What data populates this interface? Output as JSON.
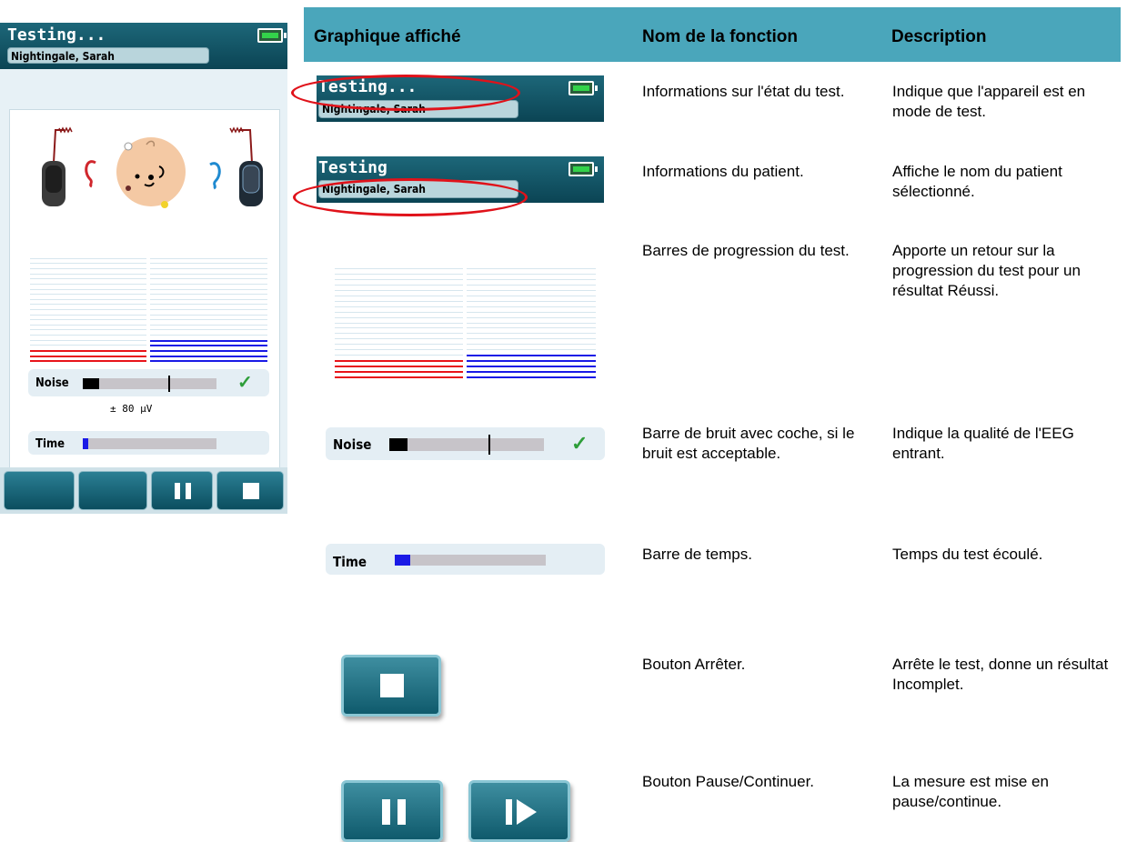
{
  "device": {
    "status_title": "Testing...",
    "patient_name": "Nightingale, Sarah",
    "noise_label": "Noise",
    "noise_value_text": "± 80 µV",
    "time_label": "Time",
    "noise_level": 0.12,
    "noise_threshold": 0.64,
    "time_progress": 0.04,
    "left_progress_lines": 3,
    "right_progress_lines": 5,
    "total_lines": 21,
    "colors": {
      "left_ear": "#e8141a",
      "right_ear": "#1a1ae6",
      "header": "#0b4454",
      "check": "#2e9e3a"
    },
    "icons": [
      "battery-icon",
      "left-ear-icon",
      "right-ear-icon",
      "baby-face-icon",
      "left-probe-icon",
      "right-probe-icon",
      "check-icon",
      "pause-icon",
      "stop-icon"
    ]
  },
  "table": {
    "headers": [
      "Graphique affiché",
      "Nom de la fonction",
      "Description"
    ],
    "rows": [
      {
        "function": "Informations sur l'état du test.",
        "description": "Indique que l'appareil est en mode de test."
      },
      {
        "function": "Informations du patient.",
        "description": "Affiche le nom du patient sélectionné."
      },
      {
        "function": "Barres de progression du test.",
        "description": "Apporte un retour sur la progression du test pour un résultat Réussi."
      },
      {
        "function": "Barre de bruit avec coche, si le bruit est acceptable.",
        "description": "Indique la qualité de l'EEG entrant."
      },
      {
        "function": "Barre de temps.",
        "description": "Temps du test écoulé."
      },
      {
        "function": "Bouton Arrêter.",
        "description": "Arrête le test, donne un résultat Incomplet."
      },
      {
        "function": "Bouton Pause/Continuer.",
        "description": "La mesure est mise en pause/continue."
      }
    ],
    "row1_title": "Testing...",
    "row1_name": "Nightingale, Sarah",
    "row2_title": "Testing",
    "row2_name": "Nightingale, Sarah",
    "noise_label": "Noise",
    "time_label": "Time",
    "highlight_color": "#e0121a",
    "header_color": "#4aa6bb"
  }
}
